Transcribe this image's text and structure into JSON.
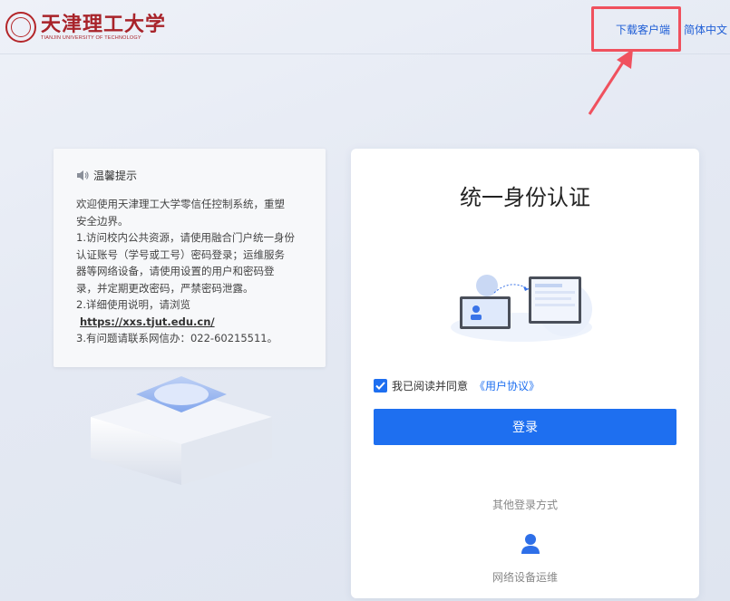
{
  "header": {
    "logo_cn": "天津理工大学",
    "logo_en": "TIANJIN UNIVERSITY OF TECHNOLOGY",
    "download_label": "下载客户端",
    "language_label": "简体中文"
  },
  "notice": {
    "title": "温馨提示",
    "lines": [
      "欢迎使用天津理工大学零信任控制系统，重塑",
      "安全边界。",
      "1.访问校内公共资源，请使用融合门户统一身份",
      "认证账号（学号或工号）密码登录；运维服务",
      "器等网络设备，请使用设置的用户和密码登",
      "录，并定期更改密码，严禁密码泄露。",
      "2.详细使用说明，请浏览"
    ],
    "link": "https://xxs.tjut.edu.cn/",
    "last_line": "3.有问题请联系网信办：022-60215511。"
  },
  "login": {
    "title": "统一身份认证",
    "agree_text": "我已阅读并同意",
    "agreement_link": "《用户协议》",
    "agreed": true,
    "login_button": "登录",
    "other_methods": "其他登录方式",
    "network_device_label": "网络设备运维"
  },
  "colors": {
    "brand_red": "#a8232a",
    "accent_blue": "#1e6ff0",
    "highlight_red": "#f0515e"
  }
}
